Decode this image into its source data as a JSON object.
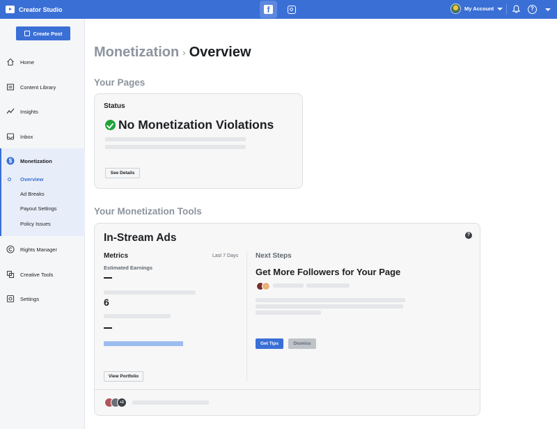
{
  "topbar": {
    "app_title": "Creator Studio",
    "platform_icons": [
      "facebook-icon",
      "instagram-icon"
    ],
    "account_label": "My Account",
    "help_glyph": "?",
    "accent_color": "#3a6fd6"
  },
  "sidebar": {
    "create_post_label": "Create Post",
    "items": [
      {
        "label": "Home",
        "icon": "home-icon"
      },
      {
        "label": "Content Library",
        "icon": "library-icon"
      },
      {
        "label": "Insights",
        "icon": "insights-icon"
      },
      {
        "label": "Inbox",
        "icon": "inbox-icon"
      },
      {
        "label": "Monetization",
        "icon": "dollar-icon",
        "active": true
      },
      {
        "label": "Rights Manager",
        "icon": "copyright-icon"
      },
      {
        "label": "Creative Tools",
        "icon": "creative-tools-icon"
      },
      {
        "label": "Settings",
        "icon": "settings-icon"
      }
    ],
    "monetization_subitems": [
      "Overview",
      "Ad Breaks",
      "Payout Settings",
      "Policy Issues"
    ],
    "active_subitem": "Overview"
  },
  "main": {
    "breadcrumb_parent": "Monetization",
    "breadcrumb_sep": "›",
    "breadcrumb_current": "Overview",
    "your_pages_title": "Your Pages",
    "status_card": {
      "label": "Status",
      "headline": "No Monetization Violations",
      "see_details_label": "See Details"
    },
    "tools_title": "Your Monetization Tools",
    "instream_card": {
      "title": "In-Stream Ads",
      "help_glyph": "?",
      "metrics_label": "Metrics",
      "range_label": "Last 7 Days",
      "estimated_earnings_label": "Estimated Earnings",
      "earnings_value": "—",
      "count_value": "6",
      "second_value": "—",
      "view_portfolio_label": "View Portfolio",
      "next_steps_label": "Next Steps",
      "next_step_title": "Get More Followers for Your Page",
      "get_tips_label": "Get Tips",
      "dismiss_label": "Dismiss",
      "footer_badge": "+2"
    }
  }
}
